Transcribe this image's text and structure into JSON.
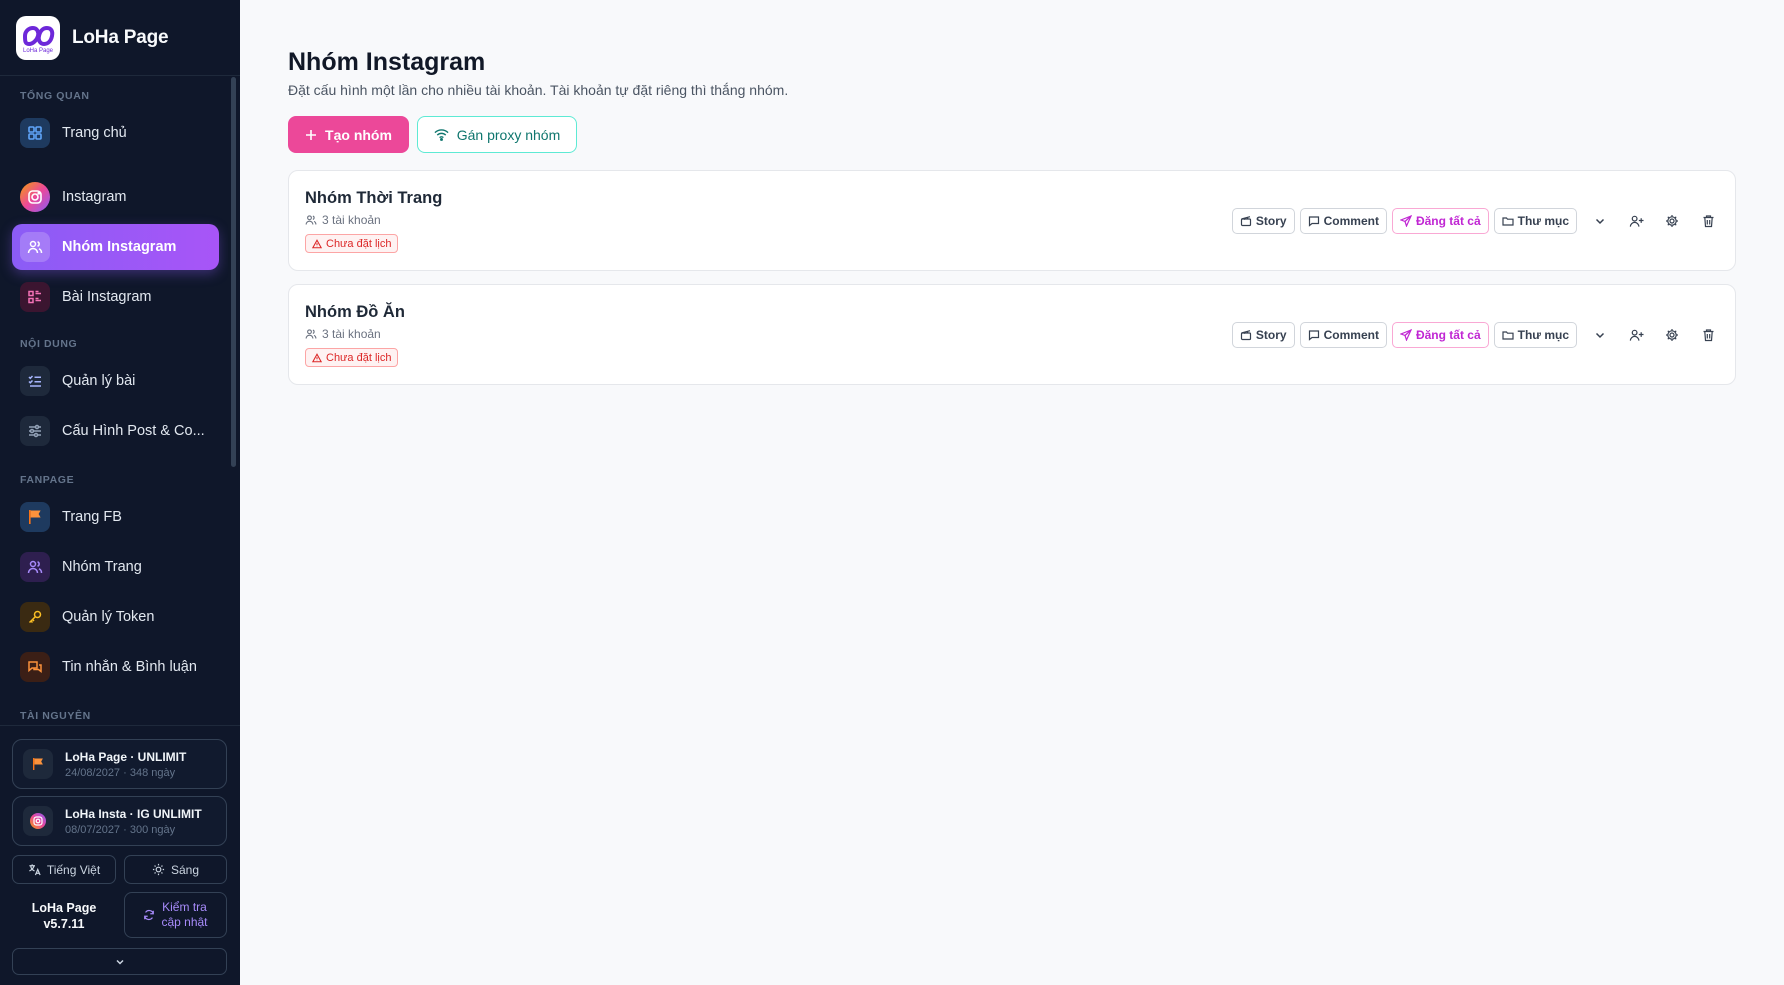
{
  "app": {
    "name": "LoHa Page",
    "logo_text": "LoHa Page"
  },
  "sidebar": {
    "sections": {
      "overview": "TỔNG QUAN",
      "content": "NỘI DUNG",
      "fanpage": "FANPAGE",
      "resources": "TÀI NGUYÊN"
    },
    "items": [
      {
        "label": "Trang chủ",
        "icon": "dashboard-icon"
      },
      {
        "label": "Instagram",
        "icon": "instagram-icon"
      },
      {
        "label": "Nhóm Instagram",
        "icon": "users-icon",
        "active": true
      },
      {
        "label": "Bài Instagram",
        "icon": "list-icon"
      },
      {
        "label": "Quản lý bài",
        "icon": "checklist-icon"
      },
      {
        "label": "Cấu Hình Post & Co...",
        "icon": "sliders-icon"
      },
      {
        "label": "Trang FB",
        "icon": "flag-icon"
      },
      {
        "label": "Nhóm Trang",
        "icon": "users-icon"
      },
      {
        "label": "Quản lý Token",
        "icon": "key-icon"
      },
      {
        "label": "Tin nhắn & Bình luận",
        "icon": "chat-icon"
      }
    ],
    "licenses": [
      {
        "title": "LoHa Page · UNLIMIT",
        "sub": "24/08/2027 · 348 ngày",
        "icon": "flag-icon"
      },
      {
        "title": "LoHa Insta · IG UNLIMIT",
        "sub": "08/07/2027 · 300 ngày",
        "icon": "instagram-icon"
      }
    ],
    "language_label": "Tiếng Việt",
    "theme_label": "Sáng",
    "version_name": "LoHa Page",
    "version_number": "v5.7.11",
    "update_label_1": "Kiểm tra",
    "update_label_2": "cập nhật"
  },
  "main": {
    "title": "Nhóm Instagram",
    "description": "Đặt cấu hình một lần cho nhiều tài khoản. Tài khoản tự đặt riêng thì thắng nhóm.",
    "create_button": "Tạo nhóm",
    "proxy_button": "Gán proxy nhóm",
    "groups": [
      {
        "name": "Nhóm Thời Trang",
        "count": "3 tài khoản",
        "status": "Chưa đặt lịch"
      },
      {
        "name": "Nhóm Đồ Ăn",
        "count": "3 tài khoản",
        "status": "Chưa đặt lịch"
      }
    ],
    "actions": {
      "story": "Story",
      "comment": "Comment",
      "post_all": "Đăng tất cả",
      "folder": "Thư mục"
    }
  },
  "colors": {
    "sidebar_bg": "#0f172a",
    "active": "#8b5cf6",
    "primary": "#ec4899",
    "teal": "#14b8a6",
    "danger": "#dc2626"
  }
}
